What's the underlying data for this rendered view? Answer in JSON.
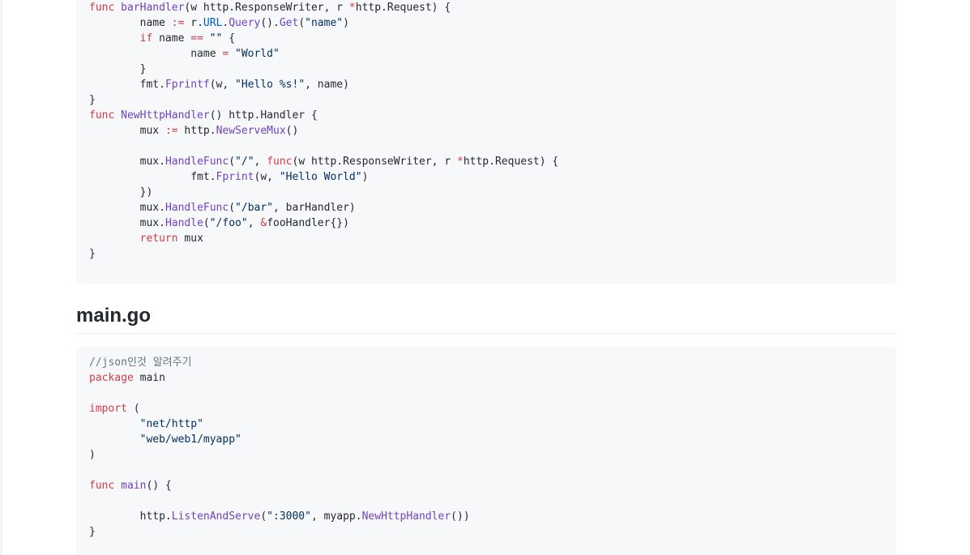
{
  "blocks": [
    {
      "lines": [
        [
          [
            "keyword",
            "func"
          ],
          [
            "plain",
            " "
          ],
          [
            "func",
            "barHandler"
          ],
          [
            "plain",
            "(w http.ResponseWriter, r "
          ],
          [
            "operator",
            "*"
          ],
          [
            "plain",
            "http.Request) {"
          ]
        ],
        [
          [
            "plain",
            "\tname "
          ],
          [
            "operator",
            ":="
          ],
          [
            "plain",
            " r."
          ],
          [
            "field",
            "URL"
          ],
          [
            "plain",
            "."
          ],
          [
            "func",
            "Query"
          ],
          [
            "plain",
            "()."
          ],
          [
            "func",
            "Get"
          ],
          [
            "plain",
            "("
          ],
          [
            "string",
            "\"name\""
          ],
          [
            "plain",
            ")"
          ]
        ],
        [
          [
            "plain",
            "\t"
          ],
          [
            "keyword",
            "if"
          ],
          [
            "plain",
            " name "
          ],
          [
            "operator",
            "=="
          ],
          [
            "plain",
            " "
          ],
          [
            "string",
            "\"\""
          ],
          [
            "plain",
            " {"
          ]
        ],
        [
          [
            "plain",
            "\t\tname "
          ],
          [
            "operator",
            "="
          ],
          [
            "plain",
            " "
          ],
          [
            "string",
            "\"World\""
          ]
        ],
        [
          [
            "plain",
            "\t}"
          ]
        ],
        [
          [
            "plain",
            "\tfmt."
          ],
          [
            "func",
            "Fprintf"
          ],
          [
            "plain",
            "(w, "
          ],
          [
            "string",
            "\"Hello %s!\""
          ],
          [
            "plain",
            ", name)"
          ]
        ],
        [
          [
            "plain",
            "}"
          ]
        ],
        [
          [
            "keyword",
            "func"
          ],
          [
            "plain",
            " "
          ],
          [
            "func",
            "NewHttpHandler"
          ],
          [
            "plain",
            "() http.Handler {"
          ]
        ],
        [
          [
            "plain",
            "\tmux "
          ],
          [
            "operator",
            ":="
          ],
          [
            "plain",
            " http."
          ],
          [
            "func",
            "NewServeMux"
          ],
          [
            "plain",
            "()"
          ]
        ],
        [
          [
            "plain",
            ""
          ]
        ],
        [
          [
            "plain",
            "\tmux."
          ],
          [
            "func",
            "HandleFunc"
          ],
          [
            "plain",
            "("
          ],
          [
            "string",
            "\"/\""
          ],
          [
            "plain",
            ", "
          ],
          [
            "keyword",
            "func"
          ],
          [
            "plain",
            "(w http.ResponseWriter, r "
          ],
          [
            "operator",
            "*"
          ],
          [
            "plain",
            "http.Request) {"
          ]
        ],
        [
          [
            "plain",
            "\t\tfmt."
          ],
          [
            "func",
            "Fprint"
          ],
          [
            "plain",
            "(w, "
          ],
          [
            "string",
            "\"Hello World\""
          ],
          [
            "plain",
            ")"
          ]
        ],
        [
          [
            "plain",
            "\t})"
          ]
        ],
        [
          [
            "plain",
            "\tmux."
          ],
          [
            "func",
            "HandleFunc"
          ],
          [
            "plain",
            "("
          ],
          [
            "string",
            "\"/bar\""
          ],
          [
            "plain",
            ", barHandler)"
          ]
        ],
        [
          [
            "plain",
            "\tmux."
          ],
          [
            "func",
            "Handle"
          ],
          [
            "plain",
            "("
          ],
          [
            "string",
            "\"/foo\""
          ],
          [
            "plain",
            ", "
          ],
          [
            "operator",
            "&"
          ],
          [
            "plain",
            "fooHandler{})"
          ]
        ],
        [
          [
            "plain",
            "\t"
          ],
          [
            "keyword",
            "return"
          ],
          [
            "plain",
            " mux"
          ]
        ],
        [
          [
            "plain",
            "}"
          ]
        ]
      ]
    },
    {
      "heading": "main.go",
      "lines": [
        [
          [
            "comment",
            "//json인것 알려주기"
          ]
        ],
        [
          [
            "keyword",
            "package"
          ],
          [
            "plain",
            " main"
          ]
        ],
        [
          [
            "plain",
            ""
          ]
        ],
        [
          [
            "keyword",
            "import"
          ],
          [
            "plain",
            " ("
          ]
        ],
        [
          [
            "plain",
            "\t"
          ],
          [
            "string",
            "\"net/http\""
          ]
        ],
        [
          [
            "plain",
            "\t"
          ],
          [
            "string",
            "\"web/web1/myapp\""
          ]
        ],
        [
          [
            "plain",
            ")"
          ]
        ],
        [
          [
            "plain",
            ""
          ]
        ],
        [
          [
            "keyword",
            "func"
          ],
          [
            "plain",
            " "
          ],
          [
            "func",
            "main"
          ],
          [
            "plain",
            "() {"
          ]
        ],
        [
          [
            "plain",
            ""
          ]
        ],
        [
          [
            "plain",
            "\thttp."
          ],
          [
            "func",
            "ListenAndServe"
          ],
          [
            "plain",
            "("
          ],
          [
            "string",
            "\":3000\""
          ],
          [
            "plain",
            ", myapp."
          ],
          [
            "func",
            "NewHttpHandler"
          ],
          [
            "plain",
            "())"
          ]
        ],
        [
          [
            "plain",
            "}"
          ]
        ]
      ]
    }
  ]
}
